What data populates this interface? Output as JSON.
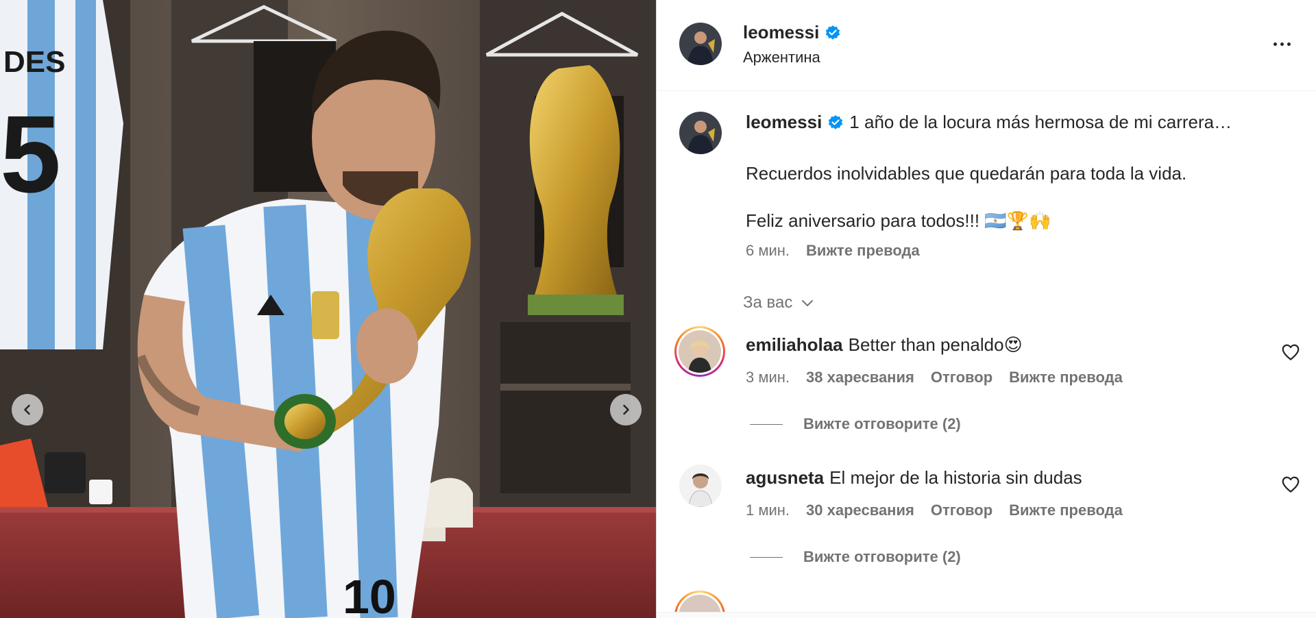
{
  "header": {
    "username": "leomessi",
    "location": "Аржентина"
  },
  "caption": {
    "username": "leomessi",
    "line1": "1 año de la locura más hermosa de mi carrera…",
    "line2": "Recuerdos inolvidables que quedarán para toda la vida.",
    "line3": "Feliz aniversario para todos!!! 🇦🇷🏆🙌",
    "time": "6 мин.",
    "translate": "Вижте превода"
  },
  "filter": {
    "label": "За вас"
  },
  "comments": [
    {
      "username": "emiliaholaa",
      "text": "Better than penaldo😍",
      "time": "3 мин.",
      "likes": "38 харесвания",
      "reply": "Отговор",
      "translate": "Вижте превода",
      "view_replies": "Вижте отговорите (2)"
    },
    {
      "username": "agusneta",
      "text": "El mejor de la historia sin dudas",
      "time": "1 мин.",
      "likes": "30 харесвания",
      "reply": "Отговор",
      "translate": "Вижте превода",
      "view_replies": "Вижте отговорите (2)"
    }
  ],
  "icons": {
    "verified": "verified-badge-icon",
    "more": "more-options-icon",
    "chevron": "chevron-down-icon",
    "heart": "heart-icon",
    "prev": "chevron-left-icon",
    "next": "chevron-right-icon"
  },
  "colors": {
    "verified": "#0095f6",
    "secondary_text": "#737373",
    "primary_text": "#262626"
  }
}
